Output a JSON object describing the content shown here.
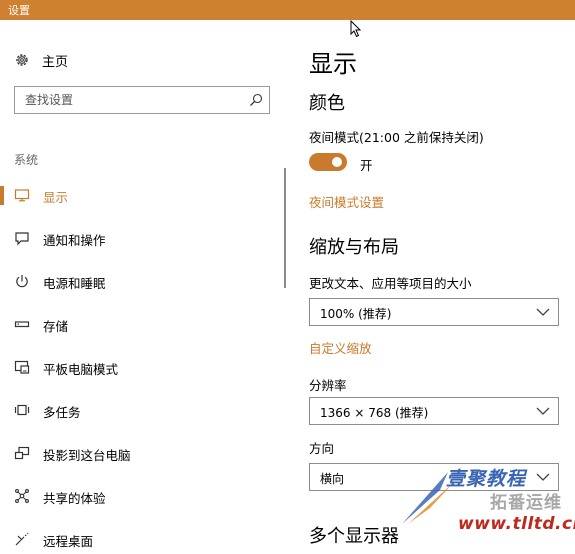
{
  "window": {
    "title": "设置"
  },
  "sidebar": {
    "home_label": "主页",
    "search_placeholder": "查找设置",
    "section_title": "系统",
    "items": [
      {
        "label": "显示",
        "icon": "monitor-icon",
        "active": true
      },
      {
        "label": "通知和操作",
        "icon": "notification-icon"
      },
      {
        "label": "电源和睡眠",
        "icon": "power-icon"
      },
      {
        "label": "存储",
        "icon": "storage-icon"
      },
      {
        "label": "平板电脑模式",
        "icon": "tablet-mode-icon"
      },
      {
        "label": "多任务",
        "icon": "multitasking-icon"
      },
      {
        "label": "投影到这台电脑",
        "icon": "project-icon"
      },
      {
        "label": "共享的体验",
        "icon": "shared-experiences-icon"
      },
      {
        "label": "远程桌面",
        "icon": "remote-desktop-icon"
      }
    ]
  },
  "main": {
    "title": "显示",
    "color_section": {
      "heading": "颜色",
      "night_light_label": "夜间模式(21:00 之前保持关闭)",
      "toggle_state": "开",
      "settings_link": "夜间模式设置"
    },
    "scale_section": {
      "heading": "缩放与布局",
      "size_label": "更改文本、应用等项目的大小",
      "size_value": "100% (推荐)",
      "custom_scaling_link": "自定义缩放",
      "resolution_label": "分辨率",
      "resolution_value": "1366 × 768 (推荐)",
      "orientation_label": "方向",
      "orientation_value": "横向"
    },
    "multi_display_heading": "多个显示器"
  },
  "watermark": {
    "line1": "壹聚教程",
    "line2": "拓番运维",
    "line3": "www.tlltd.cn"
  },
  "colors": {
    "accent": "#c97a2c",
    "titlebar": "#cf8131"
  }
}
